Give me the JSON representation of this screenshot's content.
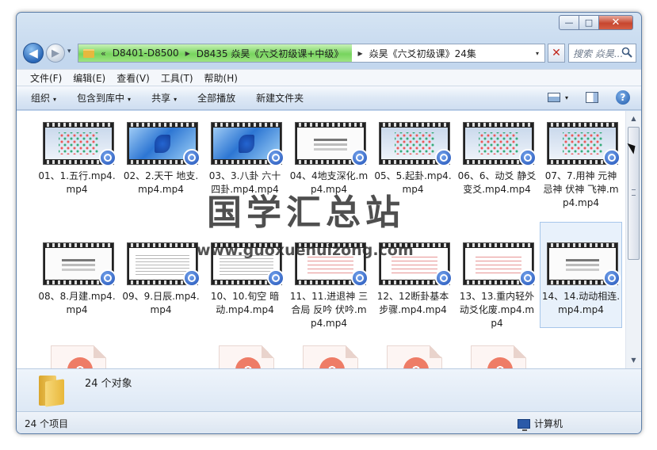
{
  "window": {
    "caption": {
      "minimize": "—",
      "maximize": "□",
      "close": "✕"
    }
  },
  "nav": {
    "back": "◀",
    "forward": "▶",
    "history": "▾",
    "address": {
      "overflow": "«",
      "parts": [
        "D8401-D8500",
        "D8435 焱昊《六爻初级课+中级》",
        "焱昊《六爻初级课》24集"
      ],
      "separator": "▶",
      "dropdown": "▾"
    },
    "clear": "✕",
    "search_placeholder": "搜索 焱昊..."
  },
  "menubar": [
    "文件(F)",
    "编辑(E)",
    "查看(V)",
    "工具(T)",
    "帮助(H)"
  ],
  "cmdbar": {
    "organize": "组织",
    "include": "包含到库中",
    "share": "共享",
    "play_all": "全部播放",
    "new_folder": "新建文件夹",
    "dropdown": "▾",
    "help": "?"
  },
  "files": [
    {
      "name": "01、1.五行.mp4.mp4",
      "thumb": "menu"
    },
    {
      "name": "02、2.天干 地支.mp4.mp4",
      "thumb": "win"
    },
    {
      "name": "03、3.八卦 六十四卦.mp4.mp4",
      "thumb": "win"
    },
    {
      "name": "04、4地支深化.mp4.mp4",
      "thumb": "white"
    },
    {
      "name": "05、5.起卦.mp4.mp4",
      "thumb": "menu"
    },
    {
      "name": "06、6、动爻 静爻 变爻.mp4.mp4",
      "thumb": "menu"
    },
    {
      "name": "07、7.用神 元神 忌神 伏神 飞神.mp4.mp4",
      "thumb": "menu"
    },
    {
      "name": "08、8.月建.mp4.mp4",
      "thumb": "white"
    },
    {
      "name": "09、9.日辰.mp4.mp4",
      "thumb": "text"
    },
    {
      "name": "10、10.旬空 暗动.mp4.mp4",
      "thumb": "text"
    },
    {
      "name": "11、11.进退神 三合局 反吟 伏吟.mp4.mp4",
      "thumb": "red"
    },
    {
      "name": "12、12断卦基本步骤.mp4.mp4",
      "thumb": "red"
    },
    {
      "name": "13、13.重内轻外 动爻化废.mp4.mp4",
      "thumb": "red"
    },
    {
      "name": "14、14.动动相连.mp4.mp4",
      "thumb": "white"
    }
  ],
  "watermark": {
    "title": "国学汇总站",
    "url": "www.guoxuehuizong.com"
  },
  "details": {
    "summary": "24 个对象"
  },
  "status": {
    "count": "24 个项目",
    "location": "计算机"
  },
  "scrollbar": {
    "up": "▲",
    "down": "▼"
  }
}
